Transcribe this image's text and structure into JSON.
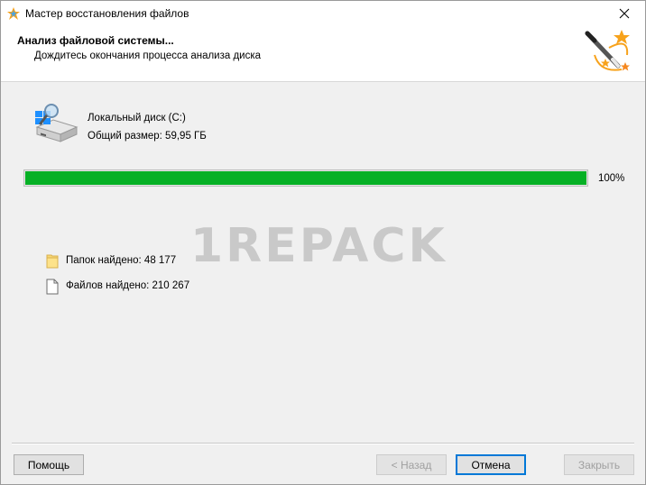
{
  "window": {
    "title": "Мастер восстановления файлов"
  },
  "header": {
    "title": "Анализ файловой системы...",
    "subtitle": "Дождитесь окончания процесса анализа диска"
  },
  "disk": {
    "name": "Локальный диск (C:)",
    "size": "Общий размер: 59,95 ГБ"
  },
  "progress": {
    "value": 1.0,
    "label": "100%",
    "color": "#06b025"
  },
  "watermark": "1REPACK",
  "stats": {
    "folders": "Папок найдено: 48 177",
    "files": "Файлов найдено: 210 267"
  },
  "buttons": {
    "help": "Помощь",
    "back": "< Назад",
    "cancel": "Отмена",
    "close": "Закрыть"
  },
  "icons": {
    "app": "wizard-app-icon",
    "close": "close-icon",
    "wizard": "magic-wand-icon",
    "disk": "hard-disk-search-icon",
    "folder": "folder-icon",
    "file": "file-icon"
  }
}
